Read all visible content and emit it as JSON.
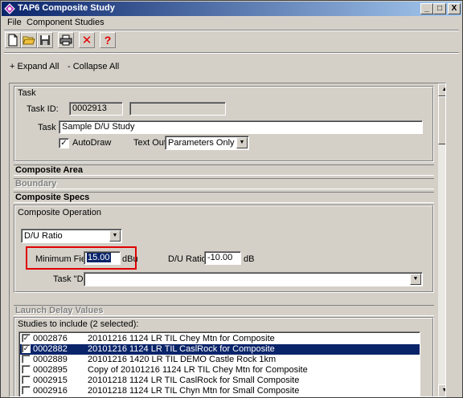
{
  "window": {
    "title": "TAP6 Composite Study",
    "minimize": "_",
    "maximize": "□",
    "close": "X"
  },
  "menu": {
    "file": "File",
    "component_studies": "Component Studies"
  },
  "toolbar": {
    "tools": [
      "new-icon",
      "open-icon",
      "save-icon",
      "print-icon",
      "delete-icon",
      "help-icon"
    ],
    "delete_glyph": "✕",
    "help_glyph": "?"
  },
  "expand": {
    "expand_all": "+ Expand All",
    "collapse_all": "- Collapse All"
  },
  "task": {
    "header": "Task",
    "id_label": "Task ID:",
    "id_value": "0002913",
    "id_extra": "",
    "task_label": "Task",
    "task_value": "Sample D/U Study",
    "autodraw_label": "AutoDraw",
    "autodraw_checked": true,
    "textout_label": "Text Out:",
    "textout_value": "Parameters Only"
  },
  "sections": {
    "composite_area": "Composite Area",
    "boundary": "Boundary",
    "composite_specs": "Composite Specs",
    "launch_delay": "Launch Delay Values"
  },
  "composite": {
    "operation_label": "Composite Operation",
    "operation_value": "D/U Ratio",
    "min_field_label": "Minimum Field",
    "min_field_value": "15.00",
    "min_field_unit": "dBu",
    "du_ratio_label": "D/U Ratio",
    "du_ratio_value": "-10.00",
    "du_ratio_unit": "dB",
    "task_d_label": "Task \"D\"",
    "task_d_value": ""
  },
  "studies": {
    "label": "Studies to include (2 selected):",
    "rows": [
      {
        "id": "0002876",
        "name": "20101216 1124 LR TIL Chey Mtn for Composite",
        "checked": true,
        "selected": false
      },
      {
        "id": "0002882",
        "name": "20101216 1124 LR TIL CaslRock for Composite",
        "checked": true,
        "selected": true
      },
      {
        "id": "0002889",
        "name": "20101216 1420 LR TIL DEMO Castle Rock 1km",
        "checked": false,
        "selected": false
      },
      {
        "id": "0002895",
        "name": "Copy of 20101216 1124 LR TIL Chey Mtn for Composite",
        "checked": false,
        "selected": false
      },
      {
        "id": "0002915",
        "name": "20101218 1124 LR TIL CaslRock for Small Composite",
        "checked": false,
        "selected": false
      },
      {
        "id": "0002916",
        "name": "20101218 1124 LR TIL Chyn Mtn for Small Composite",
        "checked": false,
        "selected": false
      }
    ]
  },
  "scroll": {
    "up": "▲",
    "down": "▼"
  }
}
